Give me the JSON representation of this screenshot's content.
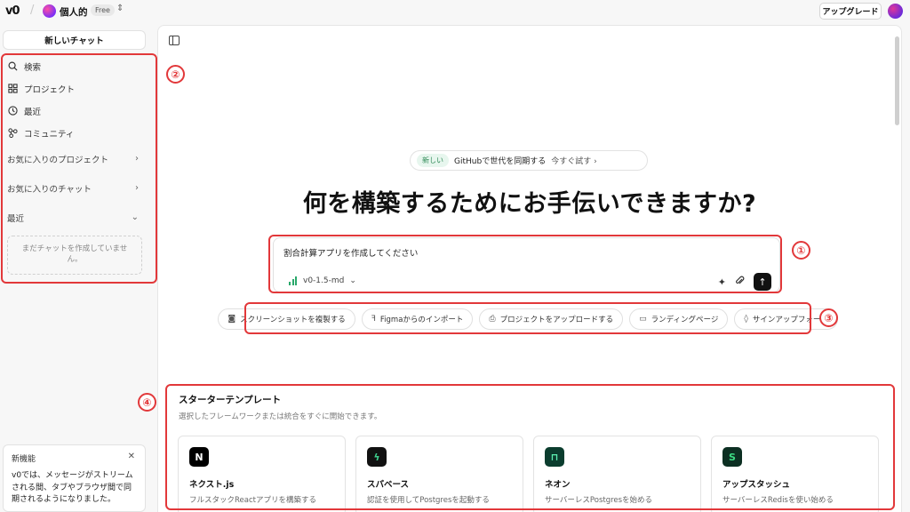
{
  "topbar": {
    "logo": "v0",
    "workspace_name": "個人的",
    "workspace_plan": "Free",
    "upgrade_label": "アップグレード"
  },
  "sidebar": {
    "new_chat_label": "新しいチャット",
    "nav": [
      {
        "label": "検索",
        "icon": "search-icon"
      },
      {
        "label": "プロジェクト",
        "icon": "grid-icon"
      },
      {
        "label": "最近",
        "icon": "clock-icon"
      },
      {
        "label": "コミュニティ",
        "icon": "community-icon"
      }
    ],
    "sections": [
      {
        "label": "お気に入りのプロジェクト"
      },
      {
        "label": "お気に入りのチャット"
      },
      {
        "label": "最近"
      }
    ],
    "empty_recent": "まだチャットを作成していません。",
    "notice": {
      "title": "新機能",
      "body": "v0では、メッセージがストリームされる間、タブやブラウザ間で同期されるようになりました。"
    }
  },
  "main": {
    "announcement": {
      "tag": "新しい",
      "message": "GitHubで世代を同期する",
      "cta": "今すぐ試す ›"
    },
    "hero_title": "何を構築するためにお手伝いできますか?",
    "prompt": {
      "value": "割合計算アプリを作成してください",
      "model": "v0-1.5-md"
    },
    "chips": [
      {
        "label": "スクリーンショットを複製する",
        "icon": "camera-icon"
      },
      {
        "label": "Figmaからのインポート",
        "icon": "figma-icon"
      },
      {
        "label": "プロジェクトをアップロードする",
        "icon": "file-upload-icon"
      },
      {
        "label": "ランディングページ",
        "icon": "layout-icon"
      },
      {
        "label": "サインアップフォーム",
        "icon": "drop-icon"
      }
    ],
    "starter": {
      "title": "スターターテンプレート",
      "subtitle": "選択したフレームワークまたは統合をすぐに開始できます。",
      "cards": [
        {
          "name": "ネクスト.js",
          "desc": "フルスタックReactアプリを構築する",
          "icon": "nextjs-icon",
          "glyph": "N",
          "color": "#000000"
        },
        {
          "name": "スパベース",
          "desc": "認証を使用してPostgresを起動する",
          "icon": "supabase-icon",
          "glyph": "ϟ",
          "color": "#111111"
        },
        {
          "name": "ネオン",
          "desc": "サーバーレスPostgresを始める",
          "icon": "neon-icon",
          "glyph": "⊓",
          "color": "#0b3d2e"
        },
        {
          "name": "アップスタッシュ",
          "desc": "サーバーレスRedisを使い始める",
          "icon": "upstash-icon",
          "glyph": "S",
          "color": "#0c2f22"
        }
      ]
    }
  },
  "annotations": [
    "①",
    "②",
    "③",
    "④"
  ],
  "colors": {
    "annotation": "#e2383a",
    "accent_green": "#2aa86b"
  }
}
